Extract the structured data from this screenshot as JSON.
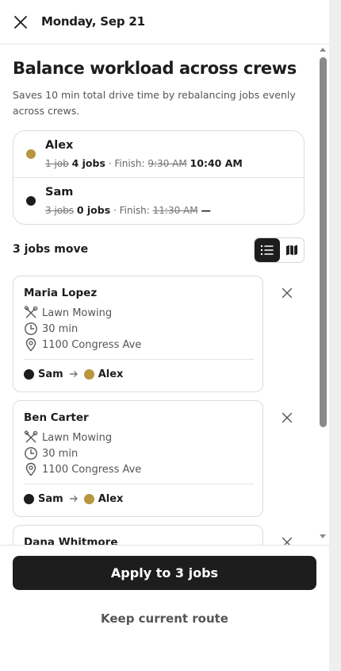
{
  "header": {
    "title": "Monday, Sep 21"
  },
  "main": {
    "title": "Balance workload across crews",
    "subtitle": "Saves 10 min total drive time by rebalancing jobs evenly across crews."
  },
  "crews": [
    {
      "name": "Alex",
      "color": "#b8963f",
      "old_jobs": "1 job",
      "new_jobs": "4 jobs",
      "finish_label": "· Finish:",
      "old_finish": "9:30 AM",
      "new_finish": "10:40 AM"
    },
    {
      "name": "Sam",
      "color": "#1d1d1d",
      "old_jobs": "3 jobs",
      "new_jobs": "0 jobs",
      "finish_label": "· Finish:",
      "old_finish": "11:30 AM",
      "new_finish": "—"
    }
  ],
  "jobs_section": {
    "label": "3 jobs move",
    "view_icons": [
      "list-icon",
      "map-icon"
    ]
  },
  "jobs": [
    {
      "name": "Maria Lopez",
      "service": "Lawn Mowing",
      "duration": "30 min",
      "address": "1100 Congress Ave",
      "from": "Sam",
      "to": "Alex"
    },
    {
      "name": "Ben Carter",
      "service": "Lawn Mowing",
      "duration": "30 min",
      "address": "1100 Congress Ave",
      "from": "Sam",
      "to": "Alex"
    },
    {
      "name": "Dana Whitmore",
      "service": "",
      "duration": "",
      "address": "",
      "from": "",
      "to": ""
    }
  ],
  "footer": {
    "apply_label": "Apply to 3 jobs",
    "keep_label": "Keep current route"
  },
  "colors": {
    "accent_dark": "#1d1d1d",
    "alex_gold": "#b8963f"
  }
}
